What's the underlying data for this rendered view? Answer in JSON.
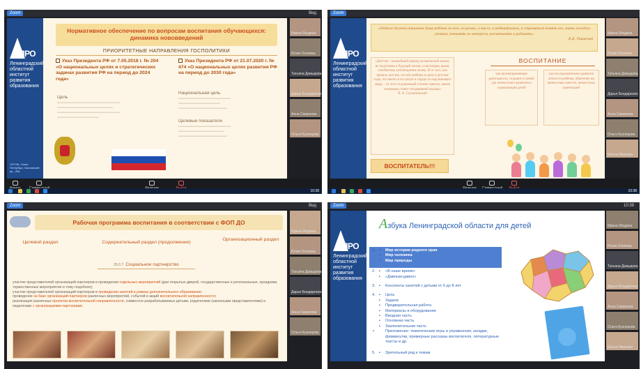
{
  "zoom": {
    "tag": "Zoom",
    "top_right_1": "Вид",
    "top_right_3": "Вид",
    "controls": [
      "Начать видео",
      "Совместный доступ",
      "Реакции",
      "Выйти"
    ],
    "clock": "10:38",
    "clock2": "10:39",
    "participants": [
      "Ирина Ягодина",
      "Юлия Осипова",
      "Татьяна Давыдова",
      "Дарья Бондаренко",
      "Анна Смирнова",
      "Ольга Кузнецова",
      "Елена Иванова"
    ]
  },
  "slide1": {
    "logo": "ОПРО",
    "logo_lines": [
      "Ленинградский",
      "областной",
      "институт",
      "развития",
      "образования"
    ],
    "logo_foot": "197136, Санкт-Петербург, Чкаловский пр., 25а",
    "title": "Нормативное обеспечение по вопросам воспитания обучающихся: динамика нововведений",
    "priorities": "ПРИОРИТЕТНЫЕ НАПРАВЛЕНИЯ ГОСПОЛИТИКИ",
    "decree_left": "Указ Президента РФ от 7.05.2018 г. № 204 «О национальных целях и стратегических задачах развития РФ на период до 2024 года»",
    "decree_right": "Указ Президента РФ от 21.07.2020 г. № 474 «О национальных целях развития РФ на период до 2030 года»",
    "label_goal": "Цель",
    "label_national_goal": "Национальная цель",
    "label_targets": "Целевые показатели"
  },
  "slide2": {
    "quote": "«Педагог должен понимать душу ребёнка не всех «в целом», в массе, а индивидуально, а стремиться понять его, знать каждого ученика, понимать их интересы, воспитывать и радовать»",
    "quote_author": "К.Д. Ушинский",
    "heading": "ВОСПИТАНИЕ",
    "box_left": "«Детство – важнейший период человеческой жизни, не подготовка к будущей жизни, а настоящая, яркая, самобытная, неповторимая жизнь. И от того, как прошло детство, кто вёл ребёнка за руку в детские годы, что вошло в его разум и сердце из окружающего мира, – от этого в решающей степени зависит, каким человеком станет сегодняшний малыш»",
    "box_left_author": "В. А. Сухомлинский",
    "box_mid": "как целенаправленная деятельность, создание условий для личностного развития и социализации детей",
    "box_right": "как последовательное развитие личности ребёнка, обретение им ценностных качеств, ценностных ориентаций",
    "banner": "ВОСПИТАТЕЛЬ!!!"
  },
  "slide3": {
    "title": "Рабочая программа воспитания в соответствии с ФОП ДО",
    "tab_left": "Целевой раздел",
    "tab_mid": "Содержательный раздел (продолжение)",
    "tab_right": "Организационный раздел",
    "subtitle_num": "29.3.7.",
    "subtitle": "Социальное партнерство",
    "p1a": "участие представителей организаций-партнеров в проведении ",
    "p1b": "отдельных мероприятий",
    "p1c": " (дни открытых дверей, государственные и региональные, праздники, торжественные мероприятия и тому подобное);",
    "p2a": "участие представителей организаций-партнеров в ",
    "p2b": "проведении занятий в рамках дополнительного образования",
    "p2c": ";",
    "p3a": "проведение ",
    "p3b": "на базе организаций-партнеров",
    "p3c": " различных мероприятий, событий и акций ",
    "p3d": "воспитательной направленности",
    "p3e": ";",
    "p4a": "реализация различных ",
    "p4b": "проектов воспитательной направленности",
    "p4c": ", совместно разрабатываемых детьми, родителями (законными представителями) и педагогами ",
    "p4d": "с организациями-партнерами",
    "p4e": "."
  },
  "slide4": {
    "title_big": "А",
    "title_rest": "збука Ленинградской области для детей",
    "items_top": [
      "Мир истории родного края",
      "Мир человека",
      "Мир природы"
    ],
    "item2": [
      "«В наше время»",
      "«Давным-давно»"
    ],
    "item3": "Конспекты занятий с детьми от 5 до 8 лет",
    "item4": [
      "Цель",
      "Задачи",
      "Предварительная работа",
      "Материалы и оборудование",
      "Вводная часть",
      "Основная часть",
      "Заключительная часть",
      "Приложение: тематические игры и упражнения, загадки, физминутки, примерные рассказы воспитателя, литературные тексты и др."
    ],
    "item5": "Зрительный ряд к темам",
    "nums": [
      "1.",
      "2.",
      "3.",
      "4.",
      "5."
    ]
  }
}
